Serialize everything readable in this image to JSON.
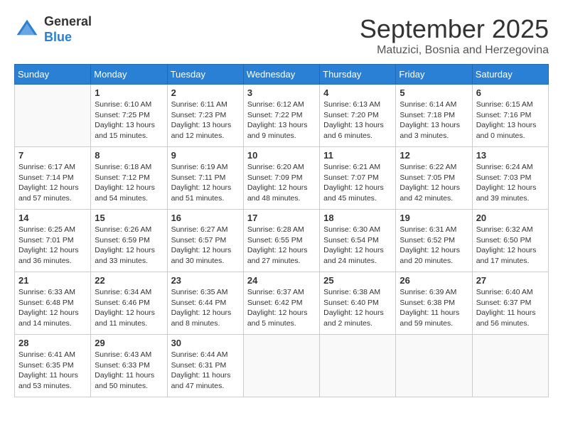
{
  "logo": {
    "general": "General",
    "blue": "Blue"
  },
  "title": "September 2025",
  "subtitle": "Matuzici, Bosnia and Herzegovina",
  "days_header": [
    "Sunday",
    "Monday",
    "Tuesday",
    "Wednesday",
    "Thursday",
    "Friday",
    "Saturday"
  ],
  "weeks": [
    [
      {
        "day": "",
        "info": ""
      },
      {
        "day": "1",
        "info": "Sunrise: 6:10 AM\nSunset: 7:25 PM\nDaylight: 13 hours\nand 15 minutes."
      },
      {
        "day": "2",
        "info": "Sunrise: 6:11 AM\nSunset: 7:23 PM\nDaylight: 13 hours\nand 12 minutes."
      },
      {
        "day": "3",
        "info": "Sunrise: 6:12 AM\nSunset: 7:22 PM\nDaylight: 13 hours\nand 9 minutes."
      },
      {
        "day": "4",
        "info": "Sunrise: 6:13 AM\nSunset: 7:20 PM\nDaylight: 13 hours\nand 6 minutes."
      },
      {
        "day": "5",
        "info": "Sunrise: 6:14 AM\nSunset: 7:18 PM\nDaylight: 13 hours\nand 3 minutes."
      },
      {
        "day": "6",
        "info": "Sunrise: 6:15 AM\nSunset: 7:16 PM\nDaylight: 13 hours\nand 0 minutes."
      }
    ],
    [
      {
        "day": "7",
        "info": "Sunrise: 6:17 AM\nSunset: 7:14 PM\nDaylight: 12 hours\nand 57 minutes."
      },
      {
        "day": "8",
        "info": "Sunrise: 6:18 AM\nSunset: 7:12 PM\nDaylight: 12 hours\nand 54 minutes."
      },
      {
        "day": "9",
        "info": "Sunrise: 6:19 AM\nSunset: 7:11 PM\nDaylight: 12 hours\nand 51 minutes."
      },
      {
        "day": "10",
        "info": "Sunrise: 6:20 AM\nSunset: 7:09 PM\nDaylight: 12 hours\nand 48 minutes."
      },
      {
        "day": "11",
        "info": "Sunrise: 6:21 AM\nSunset: 7:07 PM\nDaylight: 12 hours\nand 45 minutes."
      },
      {
        "day": "12",
        "info": "Sunrise: 6:22 AM\nSunset: 7:05 PM\nDaylight: 12 hours\nand 42 minutes."
      },
      {
        "day": "13",
        "info": "Sunrise: 6:24 AM\nSunset: 7:03 PM\nDaylight: 12 hours\nand 39 minutes."
      }
    ],
    [
      {
        "day": "14",
        "info": "Sunrise: 6:25 AM\nSunset: 7:01 PM\nDaylight: 12 hours\nand 36 minutes."
      },
      {
        "day": "15",
        "info": "Sunrise: 6:26 AM\nSunset: 6:59 PM\nDaylight: 12 hours\nand 33 minutes."
      },
      {
        "day": "16",
        "info": "Sunrise: 6:27 AM\nSunset: 6:57 PM\nDaylight: 12 hours\nand 30 minutes."
      },
      {
        "day": "17",
        "info": "Sunrise: 6:28 AM\nSunset: 6:55 PM\nDaylight: 12 hours\nand 27 minutes."
      },
      {
        "day": "18",
        "info": "Sunrise: 6:30 AM\nSunset: 6:54 PM\nDaylight: 12 hours\nand 24 minutes."
      },
      {
        "day": "19",
        "info": "Sunrise: 6:31 AM\nSunset: 6:52 PM\nDaylight: 12 hours\nand 20 minutes."
      },
      {
        "day": "20",
        "info": "Sunrise: 6:32 AM\nSunset: 6:50 PM\nDaylight: 12 hours\nand 17 minutes."
      }
    ],
    [
      {
        "day": "21",
        "info": "Sunrise: 6:33 AM\nSunset: 6:48 PM\nDaylight: 12 hours\nand 14 minutes."
      },
      {
        "day": "22",
        "info": "Sunrise: 6:34 AM\nSunset: 6:46 PM\nDaylight: 12 hours\nand 11 minutes."
      },
      {
        "day": "23",
        "info": "Sunrise: 6:35 AM\nSunset: 6:44 PM\nDaylight: 12 hours\nand 8 minutes."
      },
      {
        "day": "24",
        "info": "Sunrise: 6:37 AM\nSunset: 6:42 PM\nDaylight: 12 hours\nand 5 minutes."
      },
      {
        "day": "25",
        "info": "Sunrise: 6:38 AM\nSunset: 6:40 PM\nDaylight: 12 hours\nand 2 minutes."
      },
      {
        "day": "26",
        "info": "Sunrise: 6:39 AM\nSunset: 6:38 PM\nDaylight: 11 hours\nand 59 minutes."
      },
      {
        "day": "27",
        "info": "Sunrise: 6:40 AM\nSunset: 6:37 PM\nDaylight: 11 hours\nand 56 minutes."
      }
    ],
    [
      {
        "day": "28",
        "info": "Sunrise: 6:41 AM\nSunset: 6:35 PM\nDaylight: 11 hours\nand 53 minutes."
      },
      {
        "day": "29",
        "info": "Sunrise: 6:43 AM\nSunset: 6:33 PM\nDaylight: 11 hours\nand 50 minutes."
      },
      {
        "day": "30",
        "info": "Sunrise: 6:44 AM\nSunset: 6:31 PM\nDaylight: 11 hours\nand 47 minutes."
      },
      {
        "day": "",
        "info": ""
      },
      {
        "day": "",
        "info": ""
      },
      {
        "day": "",
        "info": ""
      },
      {
        "day": "",
        "info": ""
      }
    ]
  ]
}
